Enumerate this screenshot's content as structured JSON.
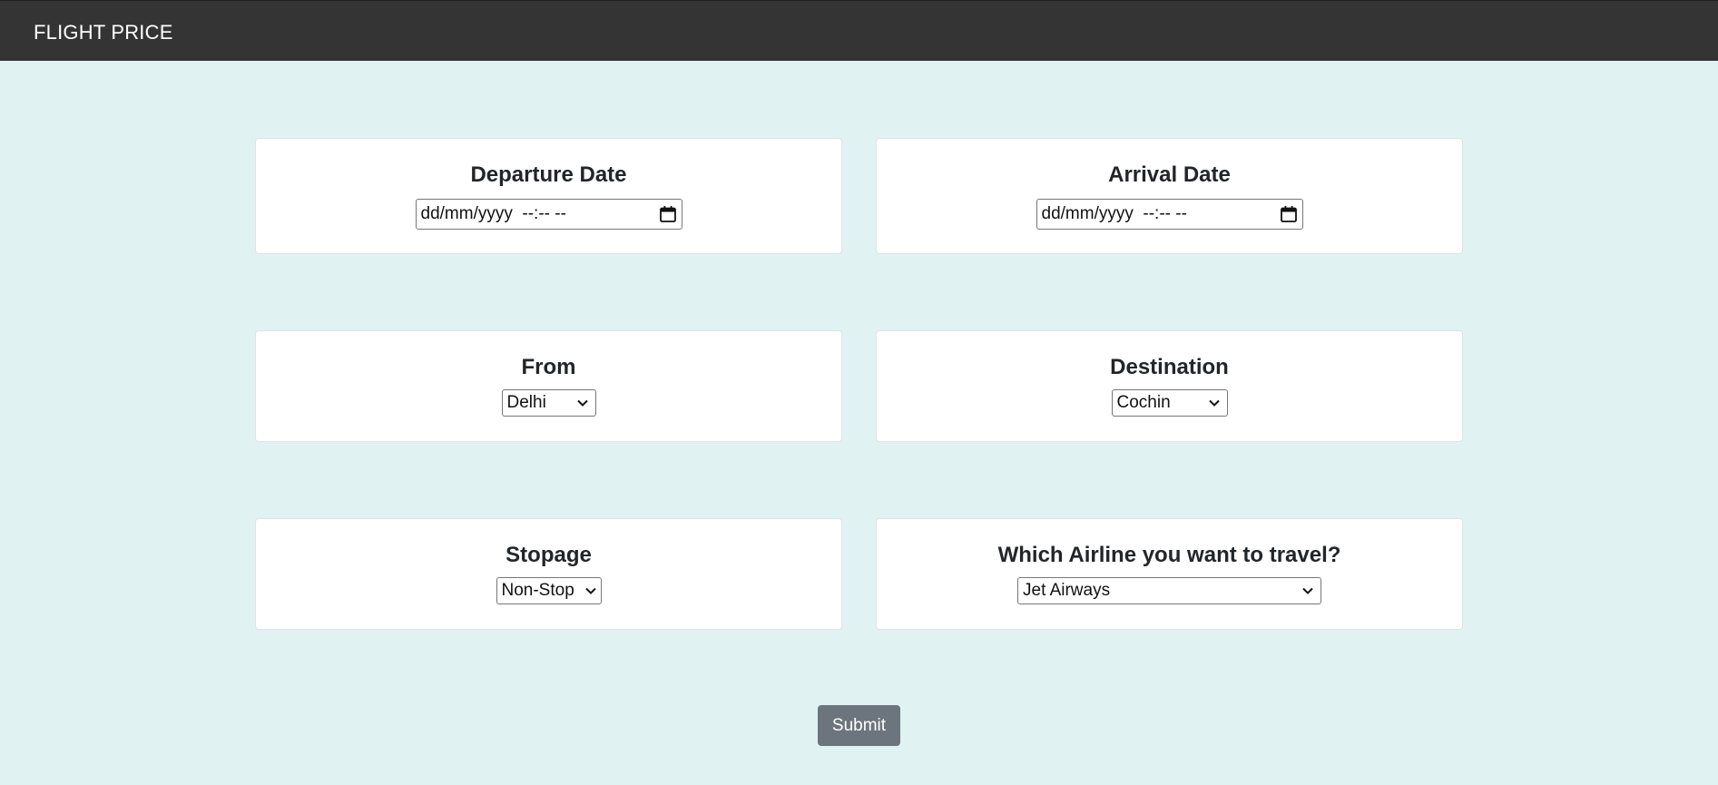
{
  "navbar": {
    "brand": "FLIGHT PRICE"
  },
  "form": {
    "departure": {
      "label": "Departure Date",
      "value": "dd/mm/yyyy  --:-- --"
    },
    "arrival": {
      "label": "Arrival Date",
      "value": "dd/mm/yyyy  --:-- --"
    },
    "source": {
      "label": "From",
      "selected": "Delhi"
    },
    "destination": {
      "label": "Destination",
      "selected": "Cochin"
    },
    "stopage": {
      "label": "Stopage",
      "selected": "Non-Stop"
    },
    "airline": {
      "label": "Which Airline you want to travel?",
      "selected": "Jet Airways"
    },
    "submit_label": "Submit"
  },
  "colors": {
    "background": "#e0f2f1",
    "navbar": "#343434",
    "submit": "#6c757d"
  },
  "icons": {
    "date_picker": "calendar-icon",
    "select": "chevron-down-icon"
  }
}
